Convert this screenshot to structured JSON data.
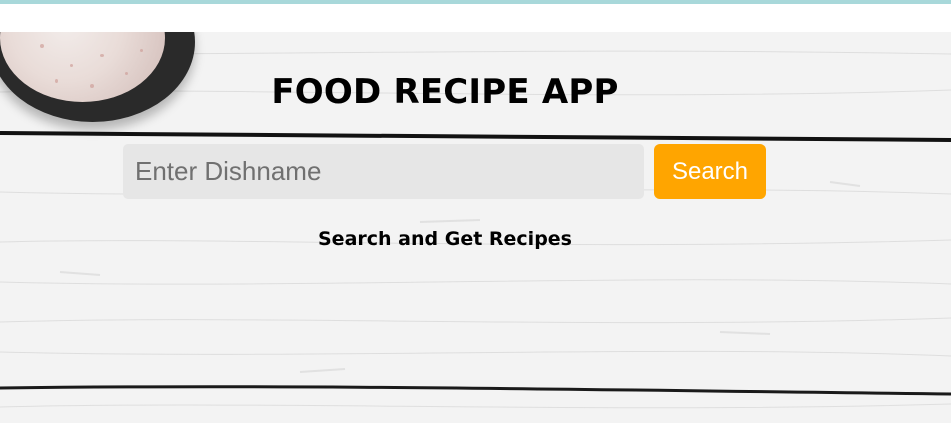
{
  "app": {
    "title": "FOOD RECIPE APP",
    "subtitle": "Search and Get Recipes"
  },
  "search": {
    "placeholder": "Enter Dishname",
    "value": "",
    "button_label": "Search"
  },
  "colors": {
    "accent": "#ffa500",
    "input_bg": "#e6e6e6",
    "browser_bar": "#a8d8da"
  },
  "images": {
    "background": "white-wood-planks",
    "bowl": "salt-bowl"
  }
}
